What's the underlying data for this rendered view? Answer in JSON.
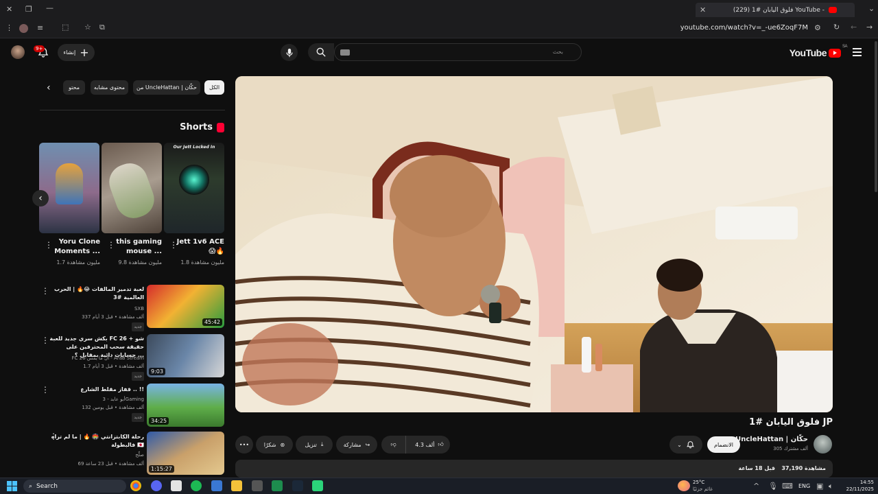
{
  "browser": {
    "tab_title": "(229) فلوق اليابان #1 YouTube -",
    "url": "youtube.com/watch?v=_-ue6ZoqF7M"
  },
  "header": {
    "brand": "YouTube",
    "region": "SA",
    "search_placeholder": "بحث",
    "create_label": "إنشاء",
    "notification_count": "9+"
  },
  "chips": [
    "الكل",
    "من UncleHattan | حكّان",
    "محتوى مشابه",
    "محتو"
  ],
  "shorts": {
    "title": "Shorts",
    "items": [
      {
        "title": "Jett 1v6 ACE 😱🔥",
        "views": "1.8 مليون مشاهدة",
        "overlay": "Our Jett Locked In"
      },
      {
        "title": "this gaming mouse ...",
        "views": "9.8 مليون مشاهدة"
      },
      {
        "title": "Yoru Clone Moments ...",
        "views": "1.7 مليون مشاهدة"
      }
    ]
  },
  "related": [
    {
      "title": "لعبة تدمير المالفات 😂🔥 | الحرب العالمية #3",
      "channel": "SXB",
      "meta": "337 ألف مشاهدة • قبل 3 أيام",
      "badge": "جديد",
      "duration": "45:42"
    },
    {
      "title": "بكش سري جديد للعبة FC 26 + شو حقيقة سحب المحترفين على حسابات دائية بمقابل ؟ ...",
      "channel": "FC 26 آل ما يمس - Arab Stream",
      "meta": "1.7 ألف مشاهدة • قبل 3 أيام",
      "badge": "جديد",
      "duration": "9:03"
    },
    {
      "title": "قفاز مقلط الشارع .. !!",
      "channel": "أبو عابد - 3Gaming",
      "meta": "132 ألف مشاهدة • قبل يومين",
      "badge": "جديد",
      "duration": "34:25"
    },
    {
      "title": "رحلة الكابتزانتي 🏟️ 🔥 | ما لم تراه فالبطولة 🇯🇵",
      "channel": "صلّح",
      "meta": "69 ألف مشاهدة • قبل 23 ساعة",
      "badge": "",
      "duration": "1:15:27"
    }
  ],
  "video": {
    "title": "فلوق اليابان #1 JP",
    "channel": "UncleHattan | حكّان",
    "subscribers": "305 ألف مشترك",
    "join_label": "الانضمام",
    "likes": "4.3 ألف",
    "share_label": "مشاركة",
    "download_label": "تنزيل",
    "thanks_label": "شكرًا",
    "views": "37,190 مشاهدة",
    "time_ago": "قبل 18 ساعة"
  },
  "taskbar": {
    "search_label": "Search",
    "weather_temp": "25°C",
    "weather_desc": "غائم جزئيًا",
    "lang": "ENG",
    "time": "14:55",
    "date": "22/11/2025"
  }
}
